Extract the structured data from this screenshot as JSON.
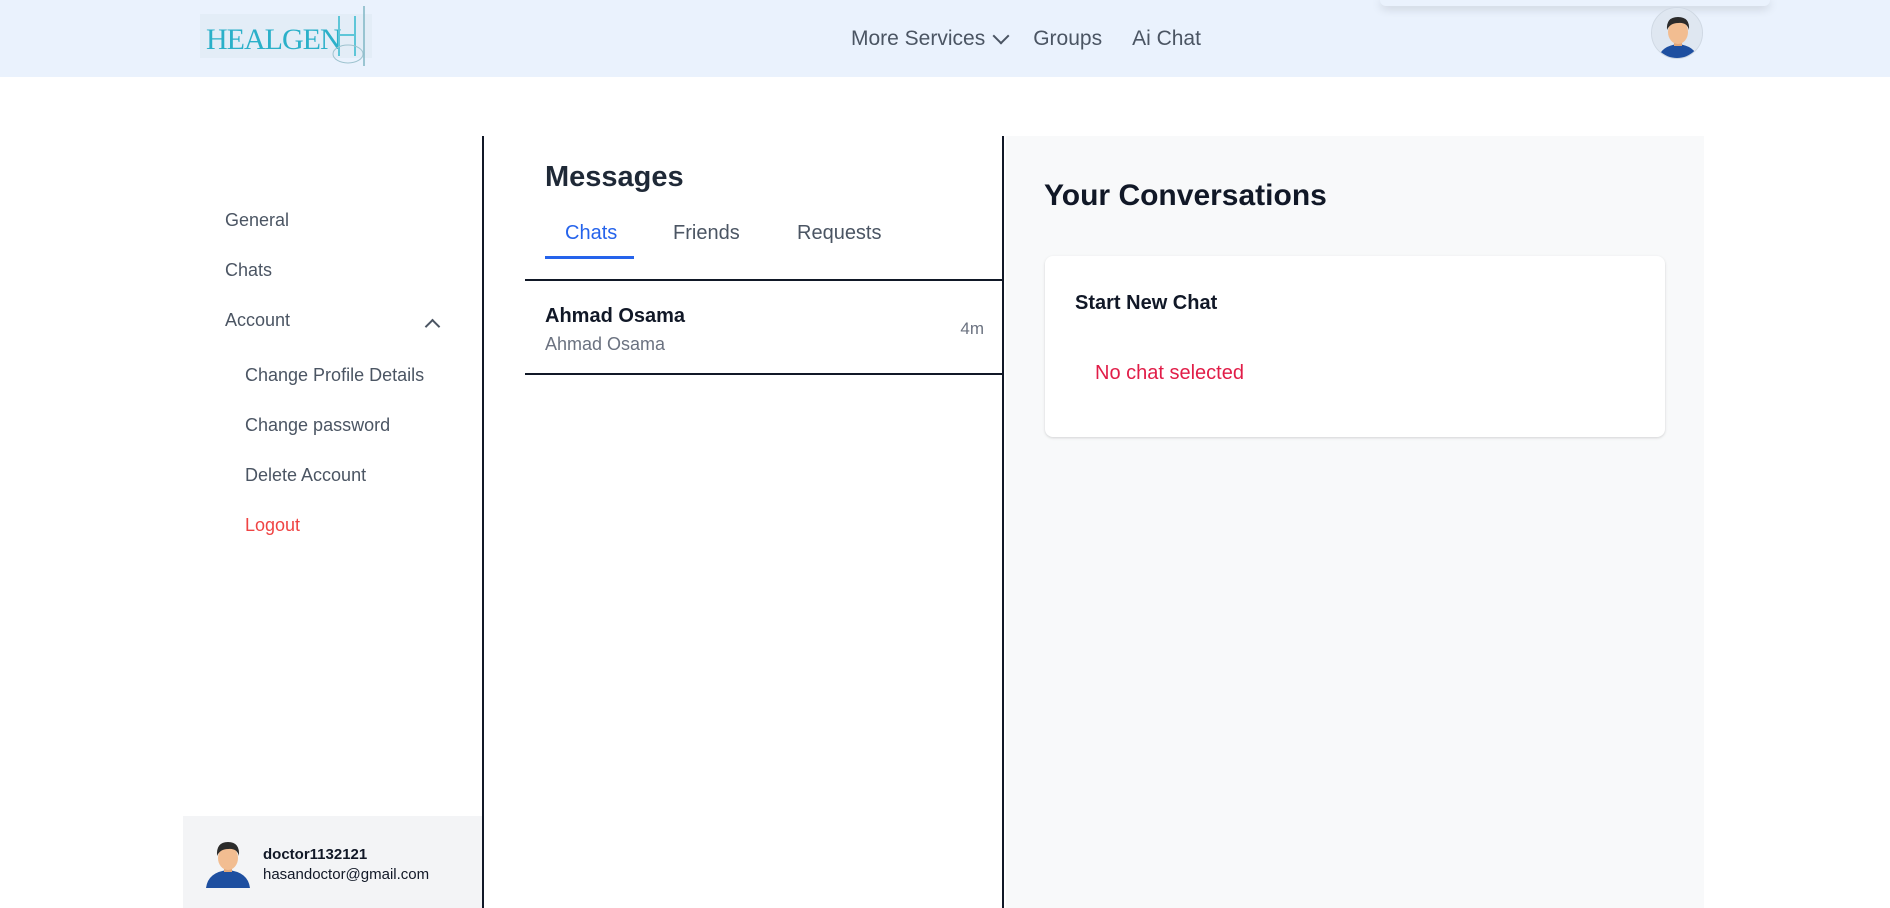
{
  "brand": {
    "logo_text": "HEALGEN"
  },
  "nav": {
    "more_services": "More Services",
    "groups": "Groups",
    "ai_chat": "Ai Chat"
  },
  "sidebar": {
    "general": "General",
    "chats": "Chats",
    "account": "Account",
    "account_items": [
      "Change Profile Details",
      "Change password",
      "Delete Account",
      "Logout"
    ],
    "user": {
      "username": "doctor1132121",
      "email": "hasandoctor@gmail.com"
    }
  },
  "messages": {
    "title": "Messages",
    "tabs": [
      "Chats",
      "Friends",
      "Requests"
    ],
    "active_tab": "Chats",
    "chats": [
      {
        "name": "Ahmad Osama",
        "preview": "Ahmad Osama",
        "time": "4m"
      }
    ]
  },
  "conversations": {
    "title": "Your Conversations",
    "card_title": "Start New Chat",
    "empty_text": "No chat selected"
  },
  "colors": {
    "navbar_bg": "#eaf2fd",
    "accent": "#2563eb",
    "danger": "#ef4444",
    "empty_state": "#e11d48",
    "panel_bg": "#f8f9fa"
  },
  "icons": {
    "nav_more": "chevron-down-icon",
    "account_toggle": "chevron-up-icon",
    "avatar": "user-avatar-icon"
  }
}
